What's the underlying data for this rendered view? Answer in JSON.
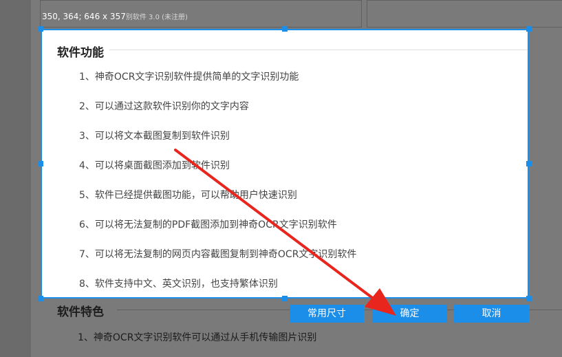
{
  "overlay": {
    "coords": "350, 364; 646 x 357",
    "behind_title": "别软件 3.0 (未注册)"
  },
  "selection_content": {
    "section_title": "软件功能",
    "items": [
      "1、神奇OCR文字识别软件提供简单的文字识别功能",
      "2、可以通过这款软件识别你的文字内容",
      "3、可以将文本截图复制到软件识别",
      "4、可以将桌面截图添加到软件识别",
      "5、软件已经提供截图功能，可以帮助用户快速识别",
      "6、可以将无法复制的PDF截图添加到神奇OCR文字识别软件",
      "7、可以将无法复制的网页内容截图复制到神奇OCR文字识别软件",
      "8、软件支持中文、英文识别，也支持繁体识别"
    ]
  },
  "background": {
    "section_title": "软件特色",
    "line1": "1、神奇OCR文字识别软件可以通过从手机传输图片识别"
  },
  "toolbar": {
    "common_size_label": "常用尺寸",
    "confirm_label": "确定",
    "cancel_label": "取消"
  },
  "colors": {
    "accent": "#1a8ee8",
    "annotation_arrow": "#e8261e"
  }
}
